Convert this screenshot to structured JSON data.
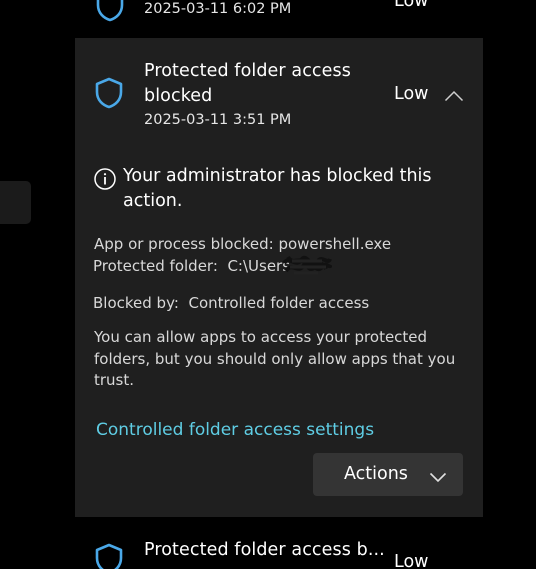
{
  "items": {
    "previous": {
      "date": "2025-03-11 6:02 PM",
      "severity": "Low"
    },
    "current": {
      "title_line1": "Protected folder access",
      "title_line2": "blocked",
      "date": "2025-03-11 3:51 PM",
      "severity": "Low",
      "info_line1": "Your administrator has blocked this",
      "info_line2": "action.",
      "details": {
        "app_label": "App or process blocked:",
        "app_value": "powershell.exe",
        "folder_label": "Protected folder:",
        "folder_value": "C:\\Users",
        "blocked_by_label": "Blocked by:",
        "blocked_by_value": "Controlled folder access"
      },
      "paragraph_line1": "You can allow apps to access your protected",
      "paragraph_line2": "folders, but you should only allow apps that you",
      "paragraph_line3": "trust.",
      "settings_link": "Controlled folder access settings",
      "actions_label": "Actions"
    },
    "next": {
      "title": "Protected folder access b...",
      "severity": "Low"
    }
  },
  "colors": {
    "background": "#000000",
    "card": "#1f1f1f",
    "shield_blue": "#4aa8e8",
    "link": "#5fcde4",
    "button": "#343434"
  },
  "icons": {
    "item_icon": "shield-icon",
    "expand_state": "chevron-up-icon",
    "info": "info-icon",
    "dropdown": "chevron-down-icon"
  }
}
